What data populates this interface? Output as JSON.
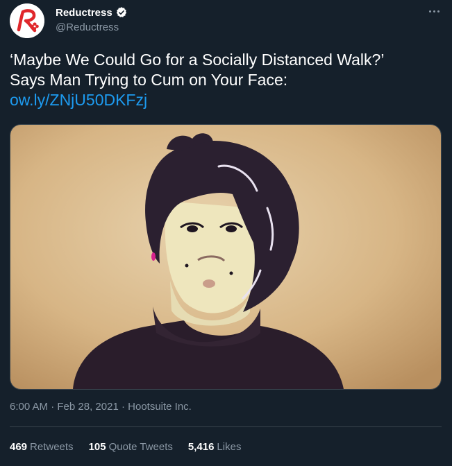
{
  "author": {
    "display_name": "Reductress",
    "handle": "@Reductress",
    "verified_icon": "verified-badge-icon",
    "avatar_icon": "reductress-logo-icon"
  },
  "tweet": {
    "text_line1": "‘Maybe We Could Go for a Socially Distanced Walk?’",
    "text_line2": "Says Man Trying to Cum on Your Face:",
    "link": "ow.ly/ZNjU50DKFzj"
  },
  "meta": {
    "time": "6:00 AM",
    "date": "Feb 28, 2021",
    "source": "Hootsuite Inc."
  },
  "stats": {
    "retweets_count": "469",
    "retweets_label": "Retweets",
    "quotes_count": "105",
    "quotes_label": "Quote Tweets",
    "likes_count": "5,416",
    "likes_label": "Likes"
  },
  "colors": {
    "background": "#15202b",
    "link": "#1d9bf0",
    "secondary_text": "#8b98a5",
    "brand_red": "#e0272b"
  }
}
